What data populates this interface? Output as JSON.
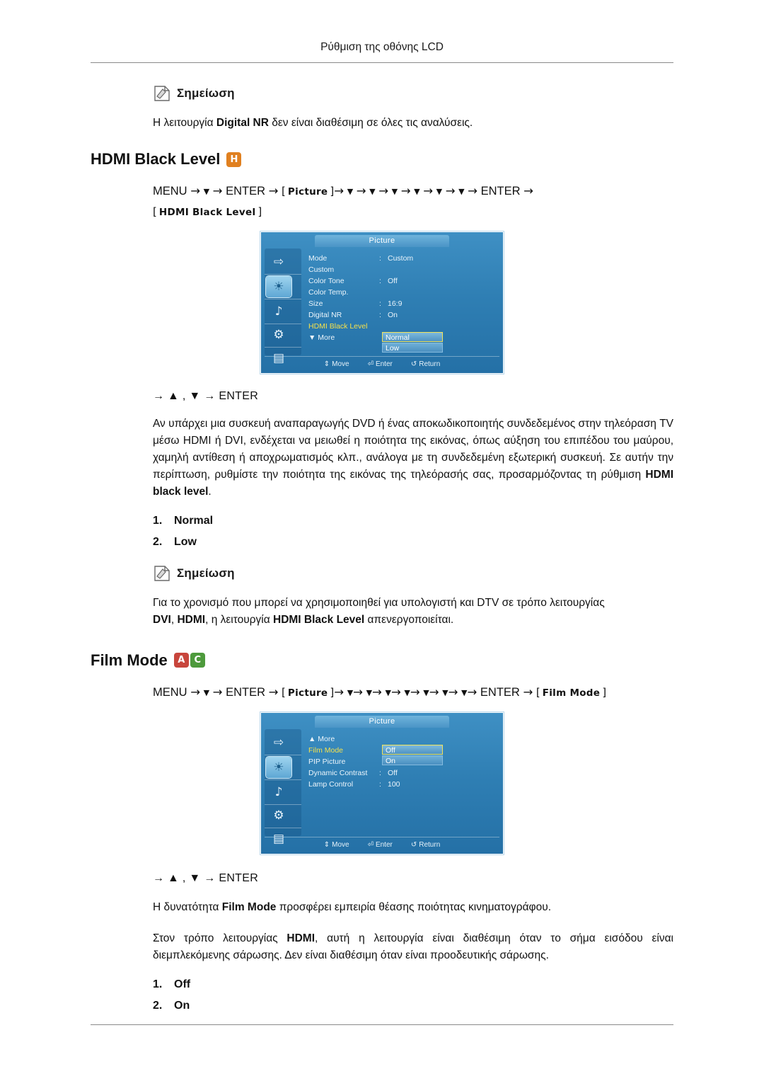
{
  "header": {
    "title": "Ρύθμιση της οθόνης LCD"
  },
  "notes": {
    "label": "Σημείωση",
    "note1": "Η λειτουργία Digital NR δεν είναι διαθέσιμη σε όλες τις αναλύσεις.",
    "note1_bold": "Digital NR",
    "note2_line1": "Για το χρονισμό που μπορεί να χρησιμοποιηθεί για υπολογιστή και DTV σε τρόπο λειτουργίας",
    "note2_line2": "DVI, HDMI, η λειτουργία HDMI Black Level απενεργοποιείται."
  },
  "section1": {
    "title": "HDMI Black Level",
    "badges": [
      "H"
    ],
    "menu_path": {
      "start": "MENU",
      "enter": "ENTER",
      "picture_token": "Picture",
      "target_token": "HDMI Black Level",
      "down_count": 6
    },
    "enter_line": "→ ▲ , ▼ → ENTER",
    "paragraph": "Αν υπάρχει μια συσκευή αναπαραγωγής DVD ή ένας αποκωδικοποιητής συνδεδεμένος στην τηλεόραση TV μέσω HDMI ή DVI, ενδέχεται να μειωθεί η ποιότητα της εικόνας, όπως αύξηση του επιπέδου του μαύρου, χαμηλή αντίθεση ή αποχρωματισμός κλπ., ανάλογα με τη συνδεδεμένη εξωτερική συσκευή. Σε αυτήν την περίπτωση, ρυθμίστε την ποιότητα της εικόνας της τηλεόρασής σας, προσαρμόζοντας τη ρύθμιση HDMI black level.",
    "paragraph_bold_tail": "HDMI black level",
    "options": [
      {
        "num": "1.",
        "label": "Normal"
      },
      {
        "num": "2.",
        "label": "Low"
      }
    ],
    "osd": {
      "title": "Picture",
      "rows": [
        {
          "label": "Mode",
          "colon": ":",
          "value": "Custom",
          "highlight": false
        },
        {
          "label": "Custom",
          "colon": "",
          "value": "",
          "highlight": false
        },
        {
          "label": "Color Tone",
          "colon": ":",
          "value": "Off",
          "highlight": false
        },
        {
          "label": "Color Temp.",
          "colon": "",
          "value": "",
          "highlight": false
        },
        {
          "label": "Size",
          "colon": ":",
          "value": "16:9",
          "highlight": false
        },
        {
          "label": "Digital NR",
          "colon": ":",
          "value": "On",
          "highlight": false
        },
        {
          "label": "HDMI Black Level",
          "colon": "",
          "value": "",
          "highlight": true
        },
        {
          "label": "▼ More",
          "colon": "",
          "value": "",
          "highlight": false
        }
      ],
      "popup": [
        {
          "label": "Normal",
          "active": true
        },
        {
          "label": "Low",
          "active": false
        }
      ],
      "footer": [
        {
          "glyph": "⇕",
          "label": "Move"
        },
        {
          "glyph": "⏎",
          "label": "Enter"
        },
        {
          "glyph": "↺",
          "label": "Return"
        }
      ],
      "sidebar_icons": [
        "input-icon",
        "picture-icon",
        "sound-icon",
        "setup-icon",
        "multi-control-icon"
      ]
    }
  },
  "section2": {
    "title": "Film Mode",
    "badges": [
      "A",
      "C"
    ],
    "menu_path": {
      "start": "MENU",
      "enter": "ENTER",
      "picture_token": "Picture",
      "target_token": "Film Mode",
      "down_count": 7
    },
    "enter_line": "→ ▲ , ▼ → ENTER",
    "paragraph1": "Η δυνατότητα Film Mode προσφέρει εμπειρία θέασης ποιότητας κινηματογράφου.",
    "paragraph1_bold": "Film Mode",
    "paragraph2": "Στον τρόπο λειτουργίας HDMI, αυτή η λειτουργία είναι διαθέσιμη όταν το σήμα εισόδου είναι διεμπλεκόμενης σάρωσης. Δεν είναι διαθέσιμη όταν είναι προοδευτικής σάρωσης.",
    "paragraph2_bold": "HDMI",
    "options": [
      {
        "num": "1.",
        "label": "Off"
      },
      {
        "num": "2.",
        "label": "On"
      }
    ],
    "osd": {
      "title": "Picture",
      "rows": [
        {
          "label": "▲ More",
          "colon": "",
          "value": "",
          "highlight": false
        },
        {
          "label": "Film Mode",
          "colon": "",
          "value": "",
          "highlight": true
        },
        {
          "label": "PIP Picture",
          "colon": "",
          "value": "",
          "highlight": false
        },
        {
          "label": "Dynamic Contrast",
          "colon": ":",
          "value": "Off",
          "highlight": false
        },
        {
          "label": "Lamp Control",
          "colon": ":",
          "value": "100",
          "highlight": false
        }
      ],
      "popup": [
        {
          "label": "Off",
          "active": true
        },
        {
          "label": "On",
          "active": false
        }
      ],
      "footer": [
        {
          "glyph": "⇕",
          "label": "Move"
        },
        {
          "glyph": "⏎",
          "label": "Enter"
        },
        {
          "glyph": "↺",
          "label": "Return"
        }
      ],
      "sidebar_icons": [
        "input-icon",
        "picture-icon",
        "sound-icon",
        "setup-icon",
        "multi-control-icon"
      ]
    }
  },
  "colors": {
    "badge_h": "#e08020",
    "badge_a": "#c8453c",
    "badge_c": "#4d9a3c",
    "osd_highlight": "#f4e04b",
    "osd_blue": "#2f7fb4"
  }
}
